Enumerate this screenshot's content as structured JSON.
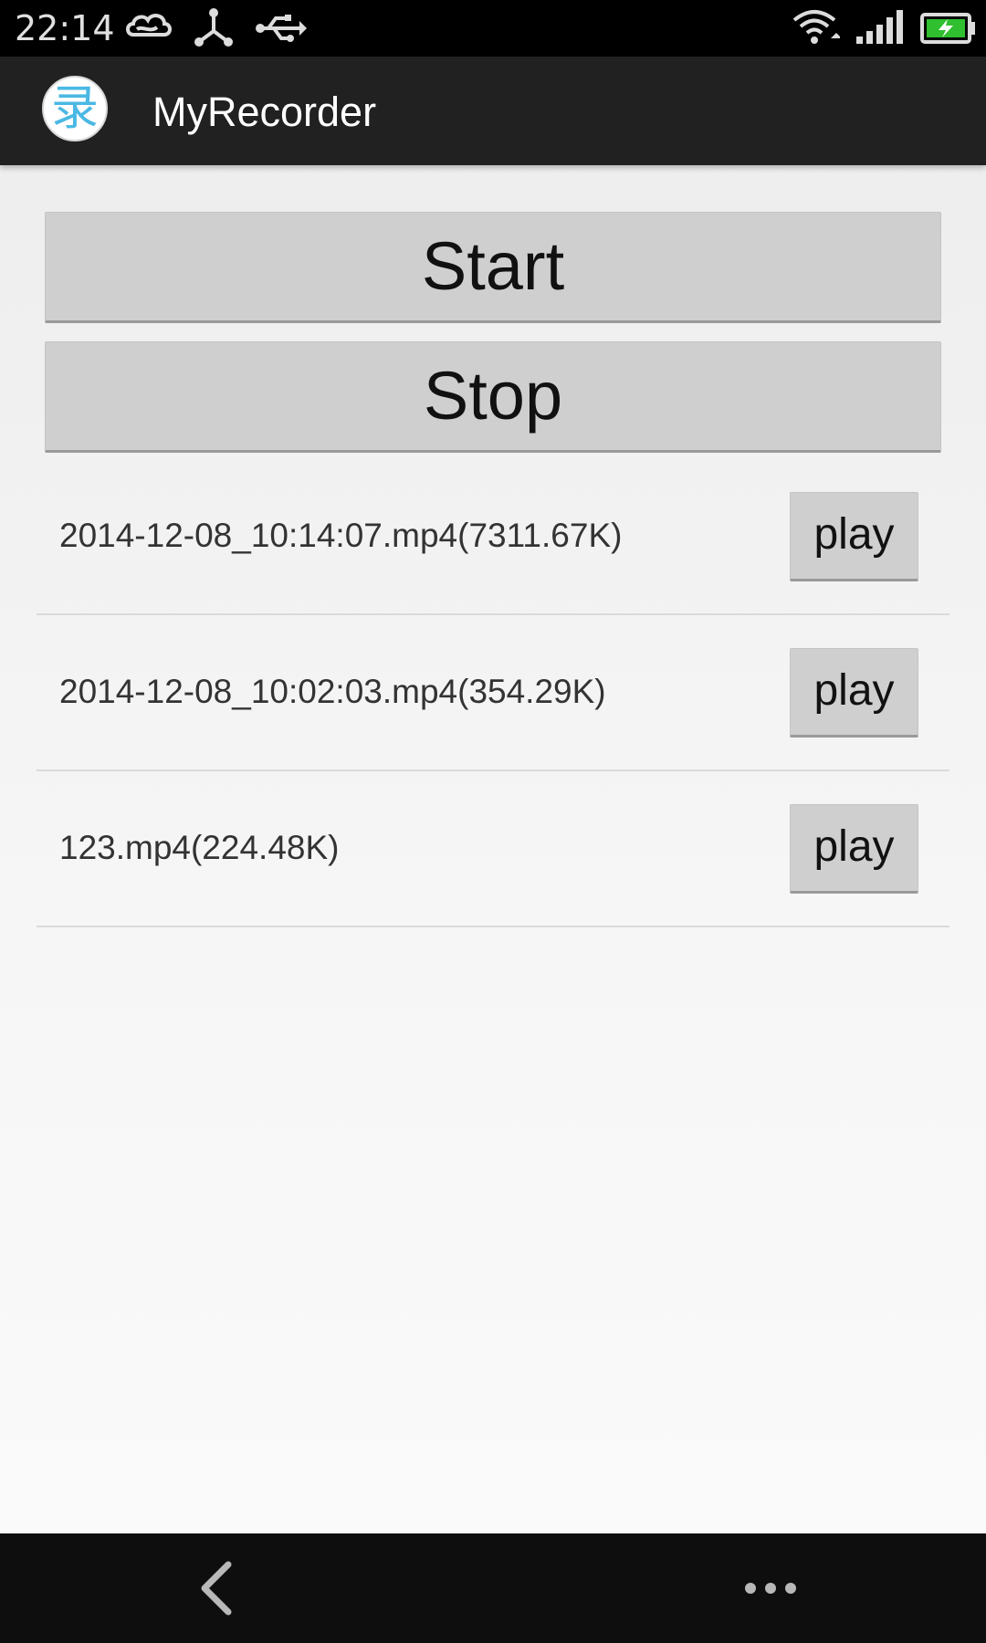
{
  "status_bar": {
    "time": "22:14",
    "icons": [
      "weather-cloud-icon",
      "share-hub-icon",
      "usb-icon",
      "wifi-icon",
      "cell-signal-icon",
      "battery-charging-icon"
    ]
  },
  "app_bar": {
    "icon_glyph": "录",
    "title": "MyRecorder"
  },
  "controls": {
    "start_label": "Start",
    "stop_label": "Stop"
  },
  "recordings": [
    {
      "name": "2014-12-08_10:14:07.mp4(7311.67K)",
      "play_label": "play"
    },
    {
      "name": "2014-12-08_10:02:03.mp4(354.29K)",
      "play_label": "play"
    },
    {
      "name": "123.mp4(224.48K)",
      "play_label": "play"
    }
  ],
  "nav_bar": {
    "icons": [
      "back-icon",
      "more-icon"
    ]
  },
  "colors": {
    "accent": "#4ab8e4",
    "battery": "#2fbf2f",
    "action_bar": "#212121",
    "button": "#cfcfcf"
  }
}
